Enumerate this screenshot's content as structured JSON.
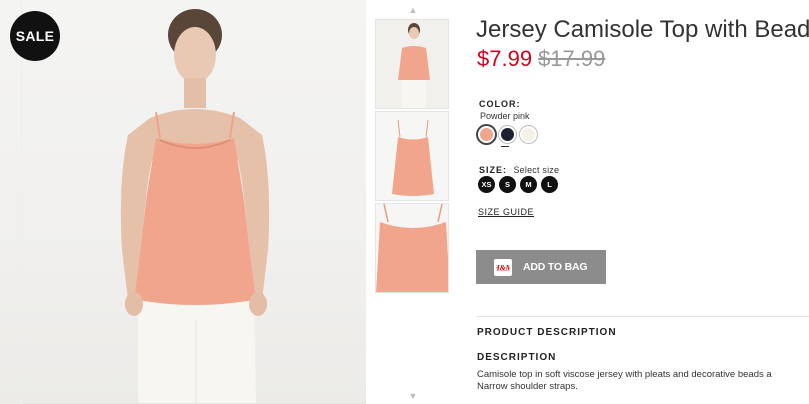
{
  "gallery": {
    "badge": "SALE",
    "thumb_up_icon": "chevron-up-icon",
    "thumb_down_icon": "chevron-down-icon"
  },
  "product": {
    "title": "Jersey Camisole Top with Beads",
    "price_sale": "$7.99",
    "price_original": "$17.99",
    "sale_color": "#d6001c"
  },
  "color": {
    "label": "COLOR:",
    "selected": "Powder pink",
    "swatches": [
      {
        "name": "Powder pink",
        "hex": "#f2a58d"
      },
      {
        "name": "Dark blue",
        "hex": "#1d2230"
      },
      {
        "name": "Cream",
        "hex": "#f5f1e6"
      }
    ]
  },
  "size": {
    "label": "SIZE:",
    "hint": "Select size",
    "options": [
      "XS",
      "S",
      "M",
      "L"
    ]
  },
  "size_guide": "SIZE GUIDE",
  "add_to_bag": {
    "label": "ADD TO BAG",
    "icon": "shopping-bag-icon",
    "icon_text": "H&M"
  },
  "description": {
    "section_heading": "PRODUCT DESCRIPTION",
    "heading": "DESCRIPTION",
    "line1": "Camisole top in soft viscose jersey with pleats and decorative beads a",
    "line2": "Narrow shoulder straps."
  }
}
